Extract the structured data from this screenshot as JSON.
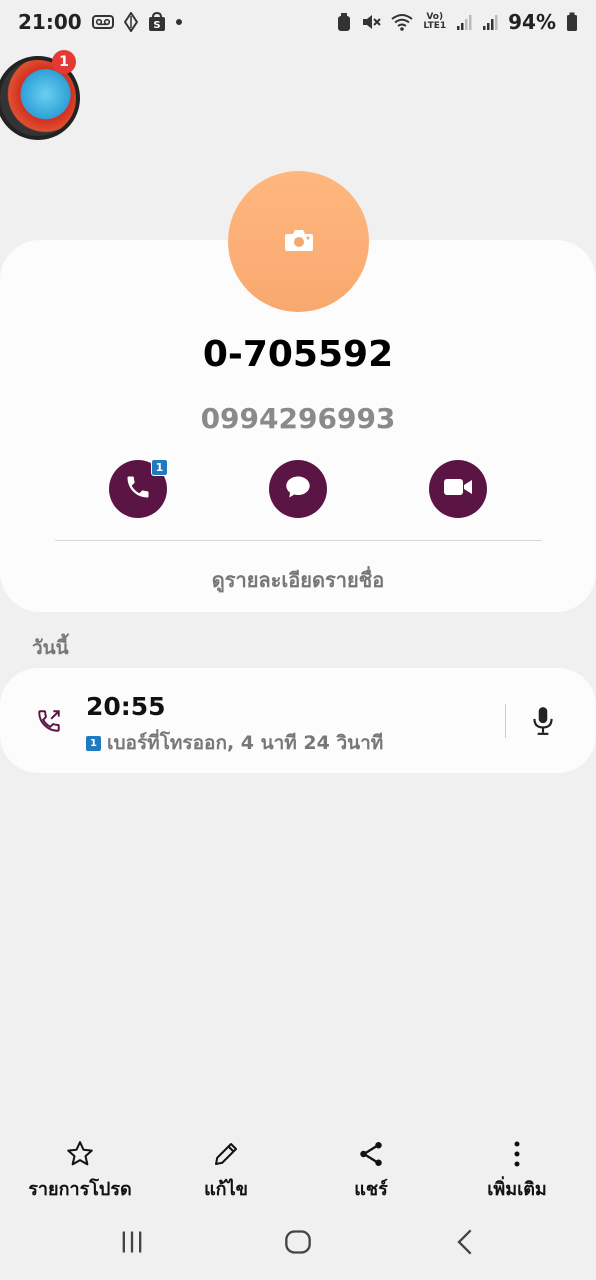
{
  "status": {
    "time": "21:00",
    "battery": "94%",
    "volte_top": "Vo)",
    "volte_bottom": "LTE1"
  },
  "bubble": {
    "badge": "1"
  },
  "contact": {
    "name": "0-705592",
    "number": "0994296993"
  },
  "actions": {
    "call_badge": "1"
  },
  "details_link": "ดูรายละเอียดรายชื่อ",
  "section": {
    "today": "วันนี้"
  },
  "log": {
    "time": "20:55",
    "sim": "1",
    "detail": "เบอร์ที่โทรออก, 4 นาที 24 วินาที"
  },
  "bottom": {
    "favorites": "รายการโปรด",
    "edit": "แก้ไข",
    "share": "แชร์",
    "more": "เพิ่มเติม"
  },
  "colors": {
    "accent": "#5b1545",
    "avatar": "#ffb77e",
    "sim": "#1e7bbf"
  }
}
